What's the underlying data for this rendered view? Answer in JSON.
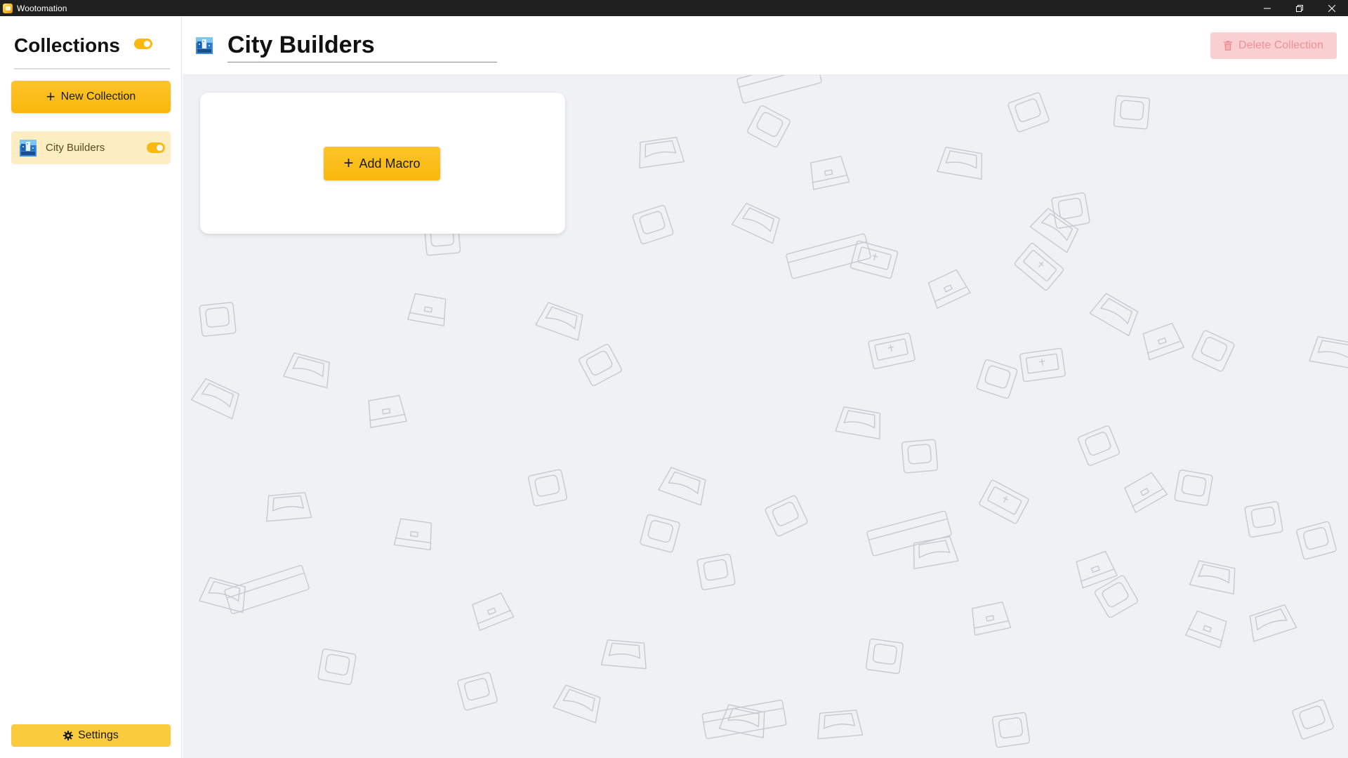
{
  "window": {
    "title": "Wootomation",
    "controls": {
      "minimize_icon": "minimize-icon",
      "restore_icon": "restore-icon",
      "close_icon": "close-icon"
    }
  },
  "sidebar": {
    "title": "Collections",
    "master_toggle_on": true,
    "new_collection_label": "New Collection",
    "collections": [
      {
        "label": "City Builders",
        "enabled": true,
        "selected": true
      }
    ],
    "settings_label": "Settings"
  },
  "main": {
    "collection_name": "City Builders",
    "delete_label": "Delete Collection",
    "delete_disabled": true,
    "add_macro_label": "Add Macro"
  },
  "colors": {
    "accent": "#f9b70c",
    "selected_item_bg": "#fcedc3",
    "delete_bg": "#f9cfd1",
    "delete_text": "#f08f96",
    "canvas_bg": "#f0f1f4"
  }
}
